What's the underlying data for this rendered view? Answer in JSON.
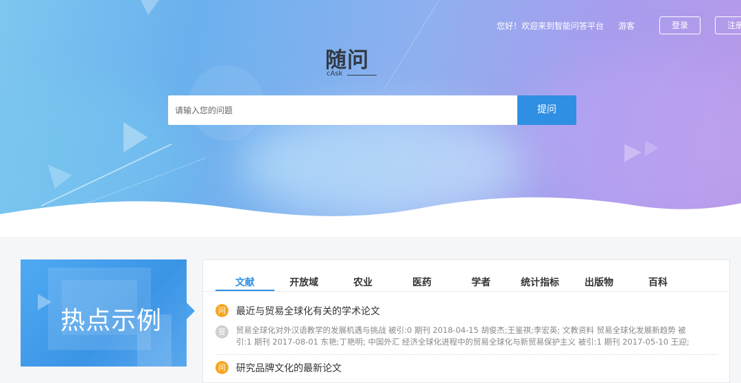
{
  "header": {
    "welcome": "您好！欢迎来到智能问答平台",
    "guest": "游客",
    "login_label": "登录",
    "register_label": "注册"
  },
  "logo": {
    "main": "随问",
    "sub": "cAsk"
  },
  "search": {
    "placeholder": "请输入您的问题",
    "button_label": "提问"
  },
  "promo": {
    "title": "热点示例"
  },
  "tabs": [
    "文献",
    "开放域",
    "农业",
    "医药",
    "学者",
    "统计指标",
    "出版物",
    "百科"
  ],
  "active_tab": "文献",
  "items": [
    {
      "question_icon": "问",
      "question": "最近与贸易全球化有关的学术论文",
      "answer_icon": "答",
      "answer_line1": "贸易全球化对外汉语教学的发展机遇与挑战 被引:0 期刊 2018-04-15 胡俊杰;王鉴祺;李宏英; 文教资料      贸易全球化发展新趋势 被",
      "answer_line2": "引:1 期刊 2017-08-01 东艳;丁艳明; 中国外汇      经济全球化进程中的贸易全球化与新贸易保护主义 被引:1 期刊 2017-05-10 王迎;"
    },
    {
      "question_icon": "问",
      "question": "研究品牌文化的最新论文"
    }
  ],
  "colors": {
    "accent": "#2f8fe2",
    "question_badge": "#f5a623",
    "answer_badge": "#cfcfcf"
  }
}
